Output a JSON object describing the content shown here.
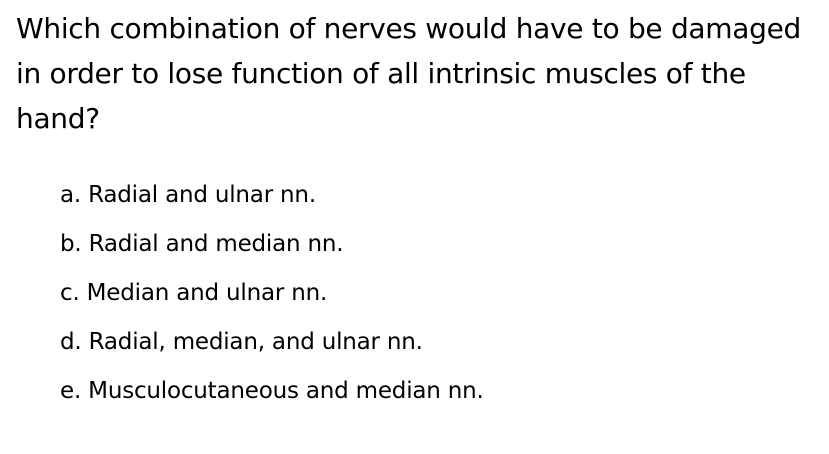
{
  "question": {
    "text": "Which combination of nerves would have to be damaged in order to lose function of all intrinsic muscles of the hand?"
  },
  "options": [
    {
      "label": "a. Radial and ulnar nn."
    },
    {
      "label": "b. Radial and median nn."
    },
    {
      "label": "c. Median and ulnar nn."
    },
    {
      "label": "d. Radial, median, and ulnar nn."
    },
    {
      "label": "e. Musculocutaneous and median nn."
    }
  ]
}
